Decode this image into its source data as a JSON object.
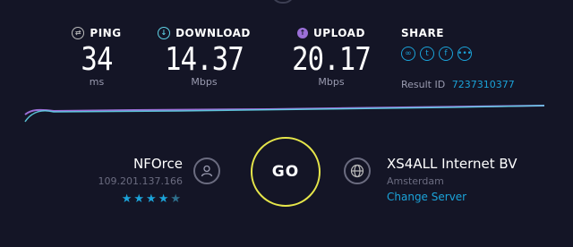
{
  "metrics": {
    "ping": {
      "label": "PING",
      "value": "34",
      "unit": "ms",
      "icon": "ping-icon"
    },
    "download": {
      "label": "DOWNLOAD",
      "value": "14.37",
      "unit": "Mbps",
      "icon": "download-arrow-icon"
    },
    "upload": {
      "label": "UPLOAD",
      "value": "20.17",
      "unit": "Mbps",
      "icon": "upload-arrow-icon"
    }
  },
  "share": {
    "label": "SHARE",
    "icons": [
      "link-icon",
      "twitter-icon",
      "facebook-icon",
      "more-icon"
    ]
  },
  "result": {
    "label": "Result ID",
    "id": "7237310377"
  },
  "isp": {
    "name": "NFOrce",
    "ip": "109.201.137.166",
    "rating": 4,
    "rating_max": 5
  },
  "go": {
    "label": "GO"
  },
  "server": {
    "name": "XS4ALL Internet BV",
    "location": "Amsterdam",
    "change_label": "Change Server"
  },
  "colors": {
    "background": "#141526",
    "accent": "#1ba3d9",
    "go_ring": "#e6e64a",
    "download_line": "#5fd3e6",
    "upload_line": "#9b6fd8"
  }
}
